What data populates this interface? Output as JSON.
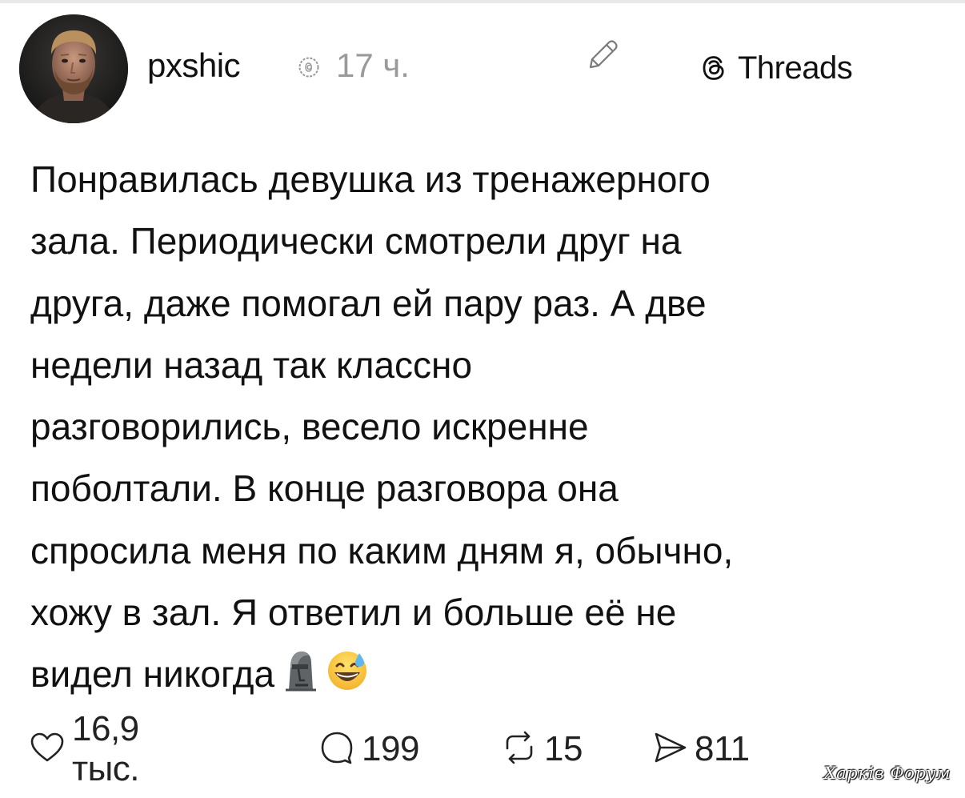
{
  "post": {
    "username": "pxshic",
    "time": "17 ч.",
    "platform_label": "Threads",
    "text_lines": [
      "Понравилась девушка из тренажерного",
      "зала. Периодически смотрели друг на",
      "друга, даже помогал ей пару раз. А две",
      "недели назад так классно",
      "разговорились, весело искренне",
      "поболтали. В конце разговора она",
      "спросила меня по каким дням я, обычно,",
      "хожу в зал. Я ответил и больше её не",
      "видел никогда"
    ],
    "emojis": [
      "moai-emoji",
      "grinning-sweat-emoji"
    ]
  },
  "stats": {
    "likes": "16,9 тыс.",
    "comments": "199",
    "reposts": "15",
    "shares": "811"
  },
  "icons": [
    "verified-icon",
    "edit-icon",
    "threads-icon",
    "heart-icon",
    "comment-icon",
    "repost-icon",
    "share-icon"
  ],
  "watermark": "Харків Форум"
}
